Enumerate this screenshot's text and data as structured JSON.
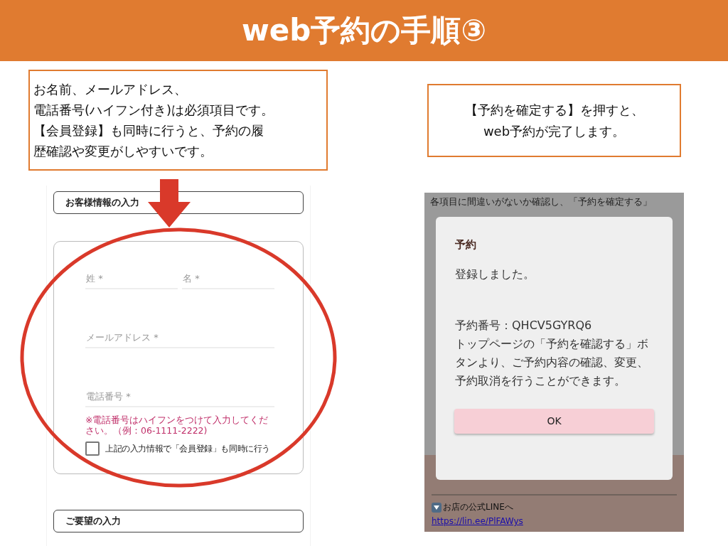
{
  "title": "web予約の手順③",
  "left": {
    "callout": [
      "お名前、メールアドレス、",
      "電話番号(ハイフン付き)は必須項目です。",
      "【会員登録】も同時に行うと、予約の履",
      "歴確認や変更がしやすいです。"
    ],
    "form": {
      "section_heading": "お客様情報の入力",
      "name_fields": [
        {
          "placeholder": "姓 *"
        },
        {
          "placeholder": "名 *"
        }
      ],
      "fields": [
        {
          "placeholder": "メールアドレス *"
        },
        {
          "placeholder": "電話番号 *"
        }
      ],
      "note": "※電話番号はハイフンをつけて入力してください。（例：06-1111-2222)",
      "checkbox": {
        "label": "上記の入力情報で「会員登録」も同時に行う",
        "checked": false
      },
      "next_section": "ご要望の入力"
    }
  },
  "right": {
    "callout": [
      "【予約を確定する】を押すと、",
      "web予約が完了します。"
    ],
    "page_text": "各項目に間違いがないか確認し、「予約を確定する」",
    "dialog": {
      "title": "予約",
      "message": "登録しました。",
      "details": [
        "予約番号：QHCV5GYRQ6",
        "トップページの「予約を確認する」ボタンより、ご予約内容の確認、変更、予約取消を行うことができます。"
      ],
      "button": "OK"
    },
    "footer": {
      "line_label": "お店の公式LINEへ",
      "link": "https://lin.ee/PlFAWys"
    }
  }
}
